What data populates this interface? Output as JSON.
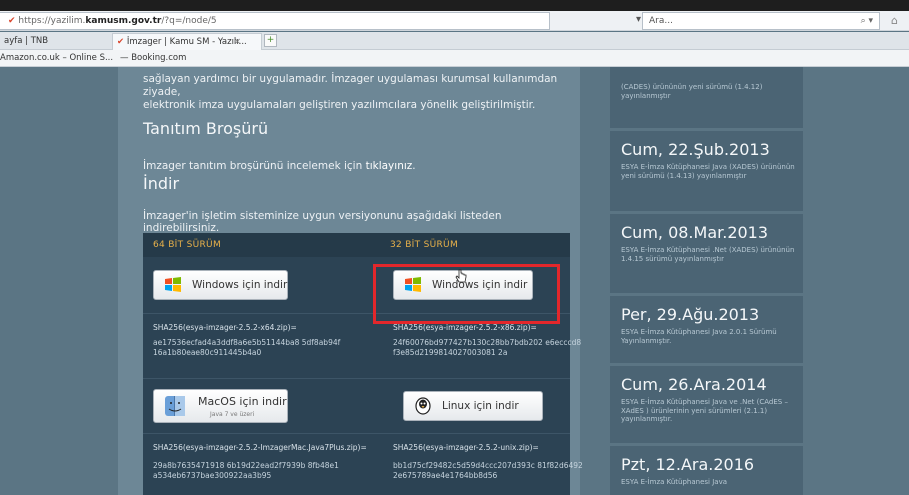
{
  "browser": {
    "url_prefix": "https://yazilim.",
    "url_domain": "kamusm.gov.tr",
    "url_suffix": "/?q=/node/5",
    "search_placeholder": "Ara...",
    "tabs": [
      {
        "label": "ayfa | TNB"
      },
      {
        "label": "İmzager | Kamu SM - Yazılı..."
      }
    ],
    "bookmarks": [
      {
        "label": "Amazon.co.uk – Online S..."
      },
      {
        "label": "Booking.com"
      }
    ]
  },
  "page": {
    "intro_line1": "sağlayan yardımcı bir uygulamadır. İmzager uygulaması kurumsal kullanımdan ziyade,",
    "intro_line2": "elektronik imza uygulamaları geliştiren yazılımcılara yönelik geliştirilmiştir.",
    "brosur_heading": "Tanıtım Broşürü",
    "brosur_text": "İmzager tanıtım broşürünü incelemek için",
    "brosur_link": "tıklayınız",
    "brosur_end": ".",
    "indir_heading": "İndir",
    "indir_text": "İmzager'in işletim sisteminize uygun versiyonunu aşağıdaki listeden indirebilirsiniz.",
    "table": {
      "col64": "64 BİT SÜRÜM",
      "col32": "32 BİT SÜRÜM",
      "win64_label": "Windows için indir",
      "win32_label": "Windows için indir",
      "hash64_title": "SHA256(esya-imzager-2.5.2-x64.zip)=",
      "hash64_value": "ae17536ecfad4a3ddf8a6e5b51144ba8 5df8ab94f16a1b80eae80c911445b4a0",
      "hash32_title": "SHA256(esya-imzager-2.5.2-x86.zip)=",
      "hash32_value": "24f60076bd977427b130c28bb7bdb202 e6ecccd8f3e85d2199814027003081 2a",
      "mac_label": "MacOS için indir",
      "mac_sub": "Java 7 ve üzeri",
      "linux_label": "Linux için indir",
      "hashmac_title": "SHA256(esya-imzager-2.5.2-ImzagerMac.Java7Plus.zip)=",
      "hashmac_value": "29a8b7635471918 6b19d22ead2f7939b 8fb48e1a534eb6737bae300922aa3b95",
      "hashunix_title": "SHA256(esya-imzager-2.5.2-unix.zip)=",
      "hashunix_value": "bb1d75cf29482c5d59d4ccc207d393c 81f82d64922e675789ae4e1764bb8d56"
    }
  },
  "sidebar": {
    "items": [
      {
        "date": "",
        "text": "(CADES) ürününün yeni sürümü (1.4.12) yayınlanmıştır"
      },
      {
        "date": "Cum, 22.Şub.2013",
        "text": "ESYA E-İmza Kütüphanesi Java (XADES) ürününün yeni sürümü (1.4.13) yayınlanmıştır"
      },
      {
        "date": "Cum, 08.Mar.2013",
        "text": "ESYA E-İmza Kütüphanesi .Net (XADES) ürününün 1.4.15 sürümü yayınlanmıştır"
      },
      {
        "date": "Per, 29.Ağu.2013",
        "text": "ESYA E-İmza Kütüphanesi Java 2.0.1 Sürümü Yayınlanmıştır."
      },
      {
        "date": "Cum, 26.Ara.2014",
        "text": "ESYA E-İmza Kütüphanesi Java ve .Net (CAdES – XAdES ) ürünlerinin yeni sürümleri (2.1.1) yayınlanmıştır."
      },
      {
        "date": "Pzt, 12.Ara.2016",
        "text": "ESYA E-İmza Kütüphanesi Java"
      }
    ]
  },
  "colors": {
    "highlight": "#e3272b",
    "table_header_text": "#e8b14a"
  }
}
